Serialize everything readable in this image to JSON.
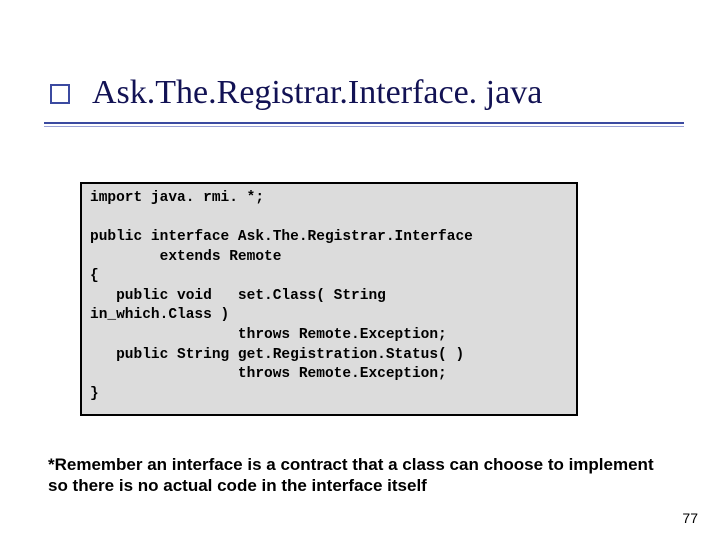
{
  "title": "Ask.The.Registrar.Interface. java",
  "code": "import java. rmi. *;\n\npublic interface Ask.The.Registrar.Interface\n        extends Remote\n{\n   public void   set.Class( String\nin_which.Class )\n                 throws Remote.Exception;\n   public String get.Registration.Status( )\n                 throws Remote.Exception;\n}",
  "note": "*Remember an interface is a contract that a class can choose to implement so there is no actual code in the interface itself",
  "page_number": "77"
}
